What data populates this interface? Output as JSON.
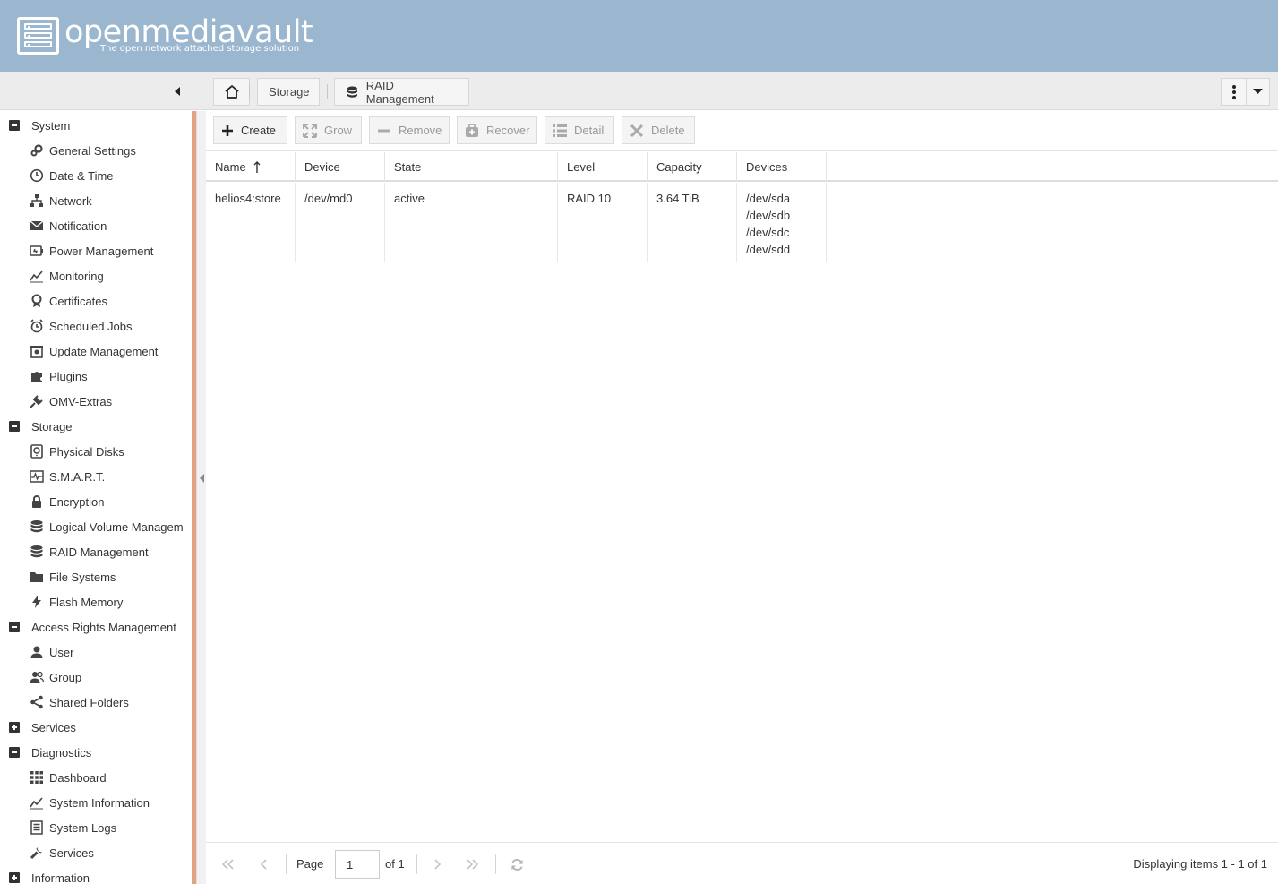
{
  "header": {
    "logo_name": "openmediavault",
    "logo_tagline": "The open network attached storage solution"
  },
  "breadcrumb": {
    "home_icon": "home-icon",
    "items": [
      {
        "label": "Storage"
      },
      {
        "label": "RAID Management",
        "icon": "database-icon"
      }
    ]
  },
  "sidebar": {
    "groups": [
      {
        "label": "System",
        "expanded": true,
        "items": [
          {
            "label": "General Settings",
            "icon": "gears-icon"
          },
          {
            "label": "Date & Time",
            "icon": "clock-icon"
          },
          {
            "label": "Network",
            "icon": "network-icon"
          },
          {
            "label": "Notification",
            "icon": "envelope-icon"
          },
          {
            "label": "Power Management",
            "icon": "power-icon"
          },
          {
            "label": "Monitoring",
            "icon": "chart-line-icon"
          },
          {
            "label": "Certificates",
            "icon": "certificate-icon"
          },
          {
            "label": "Scheduled Jobs",
            "icon": "alarm-clock-icon"
          },
          {
            "label": "Update Management",
            "icon": "update-icon"
          },
          {
            "label": "Plugins",
            "icon": "puzzle-icon"
          },
          {
            "label": "OMV-Extras",
            "icon": "plug-icon"
          }
        ]
      },
      {
        "label": "Storage",
        "expanded": true,
        "items": [
          {
            "label": "Physical Disks",
            "icon": "disk-icon"
          },
          {
            "label": "S.M.A.R.T.",
            "icon": "pulse-icon"
          },
          {
            "label": "Encryption",
            "icon": "lock-icon"
          },
          {
            "label": "Logical Volume Managem",
            "icon": "database-icon"
          },
          {
            "label": "RAID Management",
            "icon": "database-icon"
          },
          {
            "label": "File Systems",
            "icon": "folder-icon"
          },
          {
            "label": "Flash Memory",
            "icon": "flash-icon"
          }
        ]
      },
      {
        "label": "Access Rights Management",
        "expanded": true,
        "items": [
          {
            "label": "User",
            "icon": "user-icon"
          },
          {
            "label": "Group",
            "icon": "users-icon"
          },
          {
            "label": "Shared Folders",
            "icon": "share-icon"
          }
        ]
      },
      {
        "label": "Services",
        "expanded": false,
        "items": []
      },
      {
        "label": "Diagnostics",
        "expanded": true,
        "items": [
          {
            "label": "Dashboard",
            "icon": "grid-icon"
          },
          {
            "label": "System Information",
            "icon": "chart-line-icon"
          },
          {
            "label": "System Logs",
            "icon": "log-icon"
          },
          {
            "label": "Services",
            "icon": "wrench-icon"
          }
        ]
      },
      {
        "label": "Information",
        "expanded": false,
        "items": []
      }
    ]
  },
  "toolbar": {
    "create": "Create",
    "grow": "Grow",
    "remove": "Remove",
    "recover": "Recover",
    "detail": "Detail",
    "delete": "Delete"
  },
  "grid": {
    "columns": [
      "Name",
      "Device",
      "State",
      "Level",
      "Capacity",
      "Devices"
    ],
    "sort_column": "Name",
    "sort_direction": "ascending",
    "rows": [
      {
        "name": "helios4:store",
        "device": "/dev/md0",
        "state": "active",
        "level": "RAID 10",
        "capacity": "3.64 TiB",
        "devices": [
          "/dev/sda",
          "/dev/sdb",
          "/dev/sdc",
          "/dev/sdd"
        ]
      }
    ]
  },
  "pager": {
    "page_label": "Page",
    "current_page": "1",
    "of_label": "of 1",
    "display_info": "Displaying items 1 - 1 of 1"
  }
}
